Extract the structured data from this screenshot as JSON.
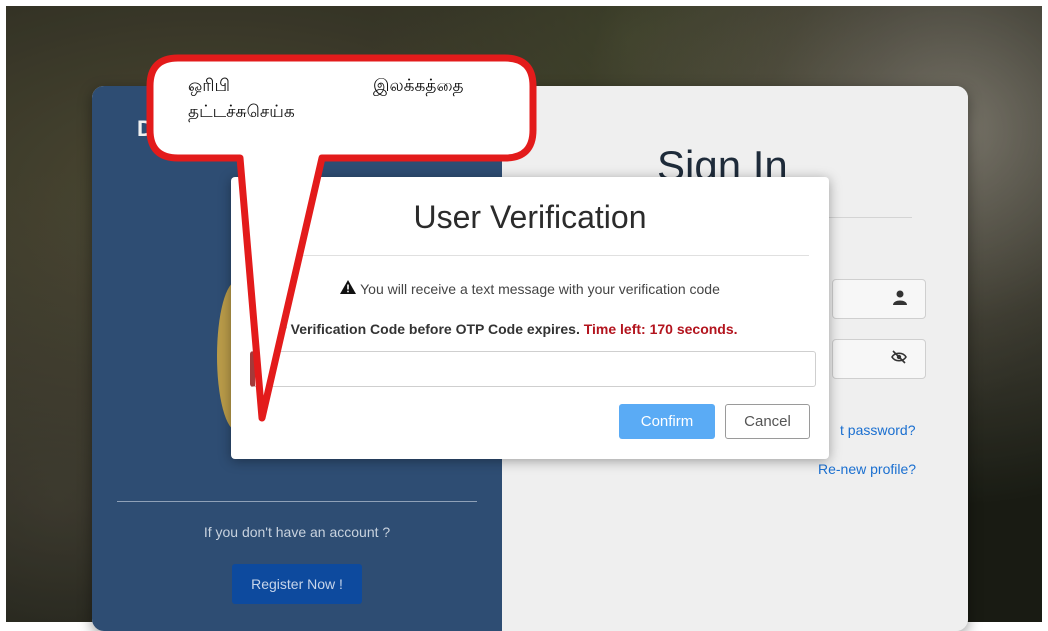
{
  "background": {
    "page_color": "#ffffff"
  },
  "login_card": {
    "logo_letter": "D",
    "no_account_text": "If you don't have an account ?",
    "register_label": "Register Now !",
    "signin_title": "Sign In",
    "forgot_link": "t password?",
    "renew_link": "Re-new profile?",
    "user_icon": "user-icon",
    "eye_icon": "eye-off-icon"
  },
  "modal": {
    "title": "User Verification",
    "notice_icon": "warning-icon",
    "notice_text": "You will receive a text message with your verification code",
    "code_prompt": "Enter Verification Code before OTP Code expires.",
    "time_left": "Time left: 170 seconds.",
    "confirm_label": "Confirm",
    "cancel_label": "Cancel",
    "input_value": ""
  },
  "callout": {
    "line1_a": "ஒரிபி",
    "line1_b": "இலக்கத்தை",
    "line2": "தட்டச்சுசெய்க",
    "border_color": "#e31b1b"
  }
}
